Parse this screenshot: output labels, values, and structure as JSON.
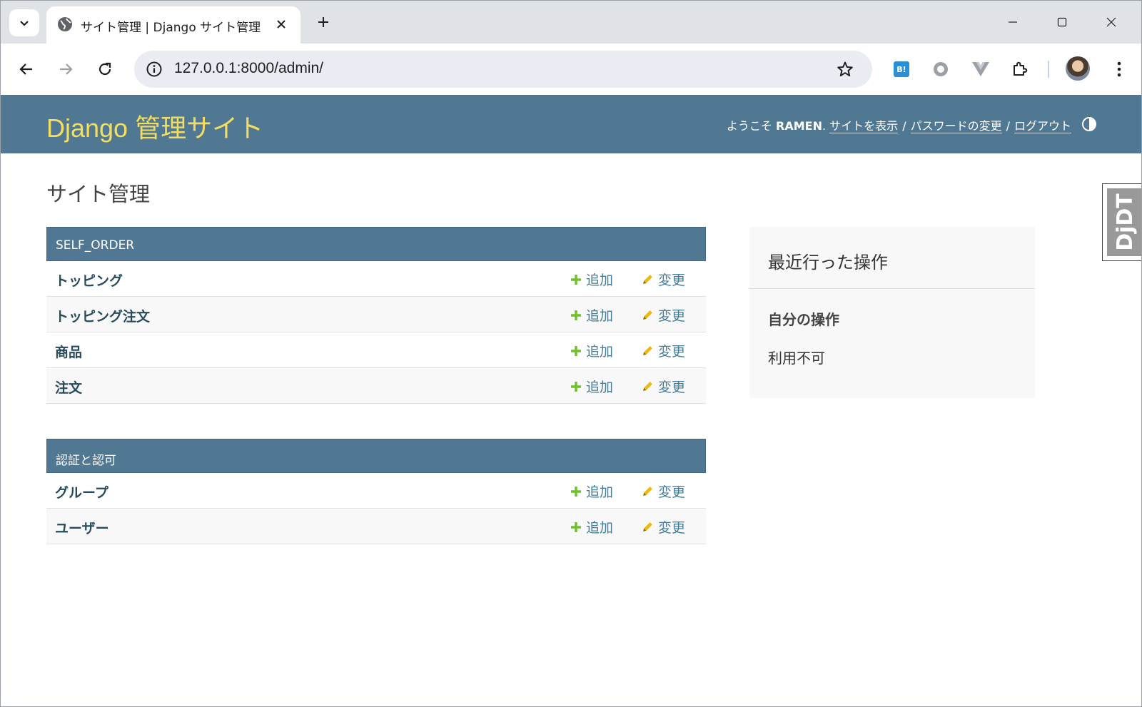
{
  "browser": {
    "tab_title": "サイト管理 | Django サイト管理",
    "url": "127.0.0.1:8000/admin/",
    "extensions": [
      "hatena-bookmark-icon",
      "circle-extension-icon",
      "vue-devtools-icon",
      "extensions-puzzle-icon"
    ],
    "hatena_label": "B!"
  },
  "header": {
    "brand": "Django 管理サイト",
    "welcome": "ようこそ",
    "username": "RAMEN",
    "dot": ".",
    "view_site": "サイトを表示",
    "change_password": "パスワードの変更",
    "logout": "ログアウト",
    "separator": "/"
  },
  "content": {
    "title": "サイト管理"
  },
  "modules": [
    {
      "caption": "SELF_ORDER",
      "rows": [
        {
          "name": "トッピング",
          "add": "追加",
          "change": "変更"
        },
        {
          "name": "トッピング注文",
          "add": "追加",
          "change": "変更"
        },
        {
          "name": "商品",
          "add": "追加",
          "change": "変更"
        },
        {
          "name": "注文",
          "add": "追加",
          "change": "変更"
        }
      ]
    },
    {
      "caption": "認証と認可",
      "rows": [
        {
          "name": "グループ",
          "add": "追加",
          "change": "変更"
        },
        {
          "name": "ユーザー",
          "add": "追加",
          "change": "変更"
        }
      ]
    }
  ],
  "recent_actions": {
    "title": "最近行った操作",
    "subtitle": "自分の操作",
    "empty": "利用不可"
  },
  "debug_toolbar": {
    "label": "DjDT"
  },
  "colors": {
    "header_bg": "#517893",
    "brand": "#f5dd5d",
    "link": "#447e9b",
    "add_icon": "#70bf2b",
    "change_icon": "#efb80b"
  }
}
